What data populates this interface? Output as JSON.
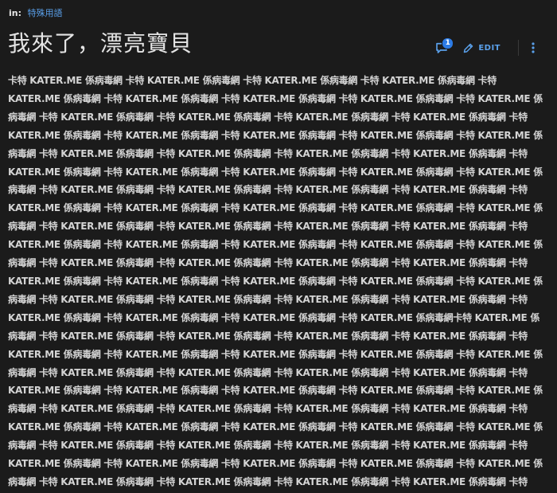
{
  "breadcrumb": {
    "prefix": "in:",
    "category": "特殊用語"
  },
  "title": "我來了，漂亮寶貝",
  "actions": {
    "comment_count": "1",
    "edit_label": "EDIT"
  },
  "colors": {
    "background": "#1b1b1b",
    "accent": "#5aa0ea",
    "badge": "#2c7be5",
    "text": "#d4d4d4"
  },
  "icons": {
    "comment": "comment-bubble-icon",
    "edit": "pencil-icon",
    "more": "vertical-dots-icon"
  },
  "body_lines": [
    "卡特 KATER.ME 係病毒網 卡特 KATER.ME 係病毒網 卡特 KATER.ME 係病毒網 卡特 KATER.ME 係病毒網 卡特",
    "KATER.ME 係病毒網 卡特 KATER.ME 係病毒網 卡特 KATER.ME 係病毒網 卡特 KATER.ME 係病毒網 卡特 KATER.ME 係",
    "病毒網 卡特 KATER.ME 係病毒網 卡特 KATER.ME 係病毒網 卡特 KATER.ME 係病毒網 卡特 KATER.ME 係病毒網 卡特",
    "KATER.ME 係病毒網 卡特 KATER.ME 係病毒網 卡特 KATER.ME 係病毒網 卡特 KATER.ME 係病毒網 卡特 KATER.ME 係",
    "病毒網 卡特 KATER.ME 係病毒網 卡特 KATER.ME 係病毒網 卡特 KATER.ME 係病毒網 卡特 KATER.ME 係病毒網 卡特",
    "KATER.ME 係病毒網 卡特 KATER.ME 係病毒網 卡特 KATER.ME 係病毒網 卡特 KATER.ME 係病毒網 卡特 KATER.ME 係",
    "病毒網 卡特 KATER.ME 係病毒網 卡特 KATER.ME 係病毒網 卡特 KATER.ME 係病毒網 卡特 KATER.ME 係病毒網 卡特",
    "KATER.ME 係病毒網 卡特 KATER.ME 係病毒網 卡特 KATER.ME 係病毒網 卡特 KATER.ME 係病毒網 卡特 KATER.ME 係",
    "病毒網 卡特 KATER.ME 係病毒網 卡特 KATER.ME 係病毒網 卡特 KATER.ME 係病毒網 卡特 KATER.ME 係病毒網 卡特",
    "KATER.ME 係病毒網 卡特 KATER.ME 係病毒網 卡特 KATER.ME 係病毒網 卡特 KATER.ME 係病毒網 卡特 KATER.ME 係",
    "病毒網 卡特 KATER.ME 係病毒網 卡特 KATER.ME 係病毒網 卡特 KATER.ME 係病毒網 卡特 KATER.ME 係病毒網 卡特",
    "KATER.ME 係病毒網 卡特 KATER.ME 係病毒網 卡特 KATER.ME 係病毒網 卡特 KATER.ME 係病毒網 卡特 KATER.ME 係",
    "病毒網 卡特 KATER.ME 係病毒網 卡特 KATER.ME 係病毒網 卡特 KATER.ME 係病毒網 卡特 KATER.ME 係病毒網 卡特",
    "KATER.ME 係病毒網 卡特 KATER.ME 係病毒網 卡特 KATER.ME 係病毒網 卡特 KATER.ME 係病毒網卡特 KATER.ME 係",
    "病毒網 卡特 KATER.ME 係病毒網 卡特 KATER.ME 係病毒網 卡特 KATER.ME 係病毒網 卡特 KATER.ME 係病毒網 卡特",
    "KATER.ME 係病毒網 卡特 KATER.ME 係病毒網 卡特 KATER.ME 係病毒網 卡特 KATER.ME 係病毒網 卡特 KATER.ME 係",
    "病毒網 卡特 KATER.ME 係病毒網 卡特 KATER.ME 係病毒網 卡特 KATER.ME 係病毒網 卡特 KATER.ME 係病毒網 卡特",
    "KATER.ME 係病毒網 卡特 KATER.ME 係病毒網 卡特 KATER.ME 係病毒網 卡特 KATER.ME 係病毒網 卡特 KATER.ME 係",
    "病毒網 卡特 KATER.ME 係病毒網 卡特 KATER.ME 係病毒網 卡特 KATER.ME 係病毒網 卡特 KATER.ME 係病毒網 卡特",
    "KATER.ME 係病毒網 卡特 KATER.ME 係病毒網 卡特 KATER.ME 係病毒網 卡特 KATER.ME 係病毒網 卡特 KATER.ME 係",
    "病毒網 卡特 KATER.ME 係病毒網 卡特 KATER.ME 係病毒網 卡特 KATER.ME 係病毒網 卡特 KATER.ME 係病毒網 卡特",
    "KATER.ME 係病毒網 卡特 KATER.ME 係病毒網 卡特 KATER.ME 係病毒網 卡特 KATER.ME 係病毒網 卡特 KATER.ME 係",
    "病毒網 卡特 KATER.ME 係病毒網 卡特 KATER.ME 係病毒網 卡特 KATER.ME 係病毒網 卡特 KATER.ME 係病毒網 卡特"
  ]
}
